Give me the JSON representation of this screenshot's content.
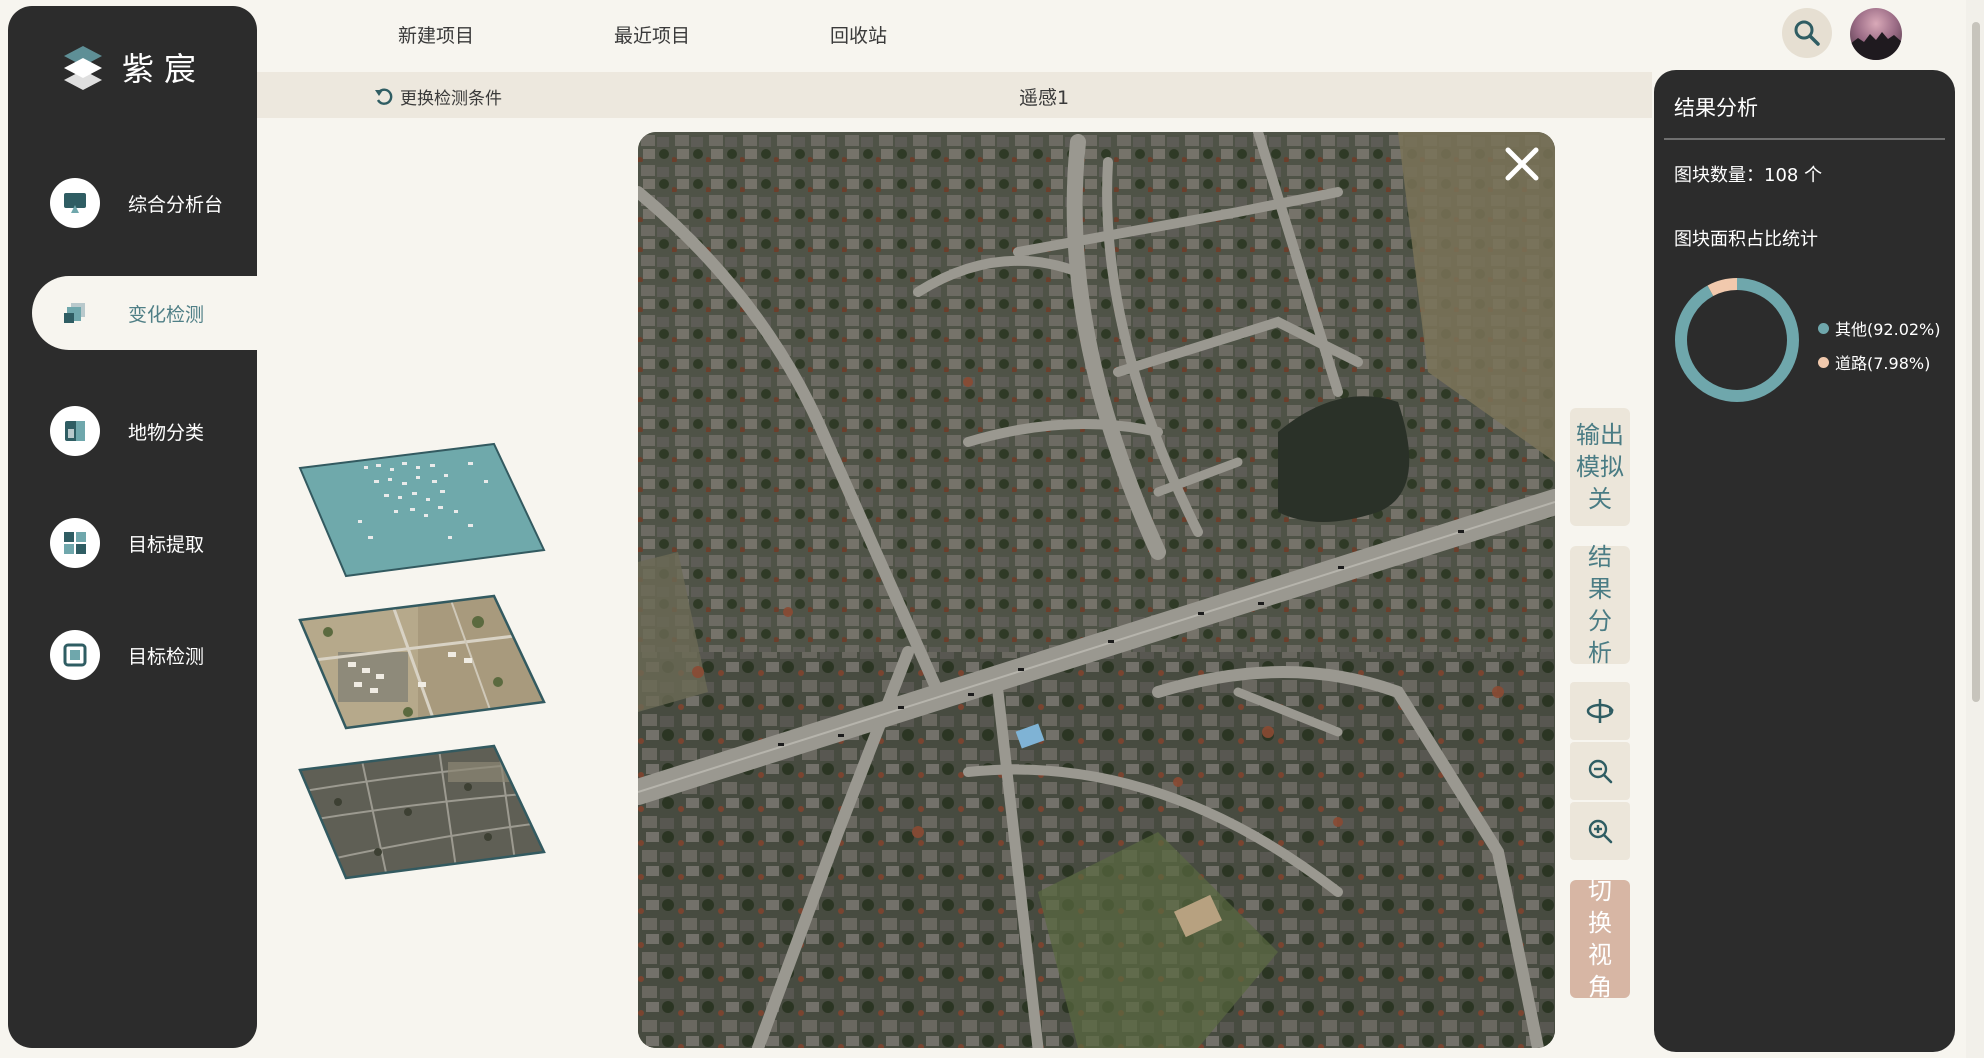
{
  "app": {
    "brand": "紫宸"
  },
  "topnav": {
    "new_project": "新建项目",
    "recent_projects": "最近项目",
    "recycle_bin": "回收站"
  },
  "sidebar": {
    "items": [
      {
        "label": "综合分析台",
        "icon": "monitor-icon"
      },
      {
        "label": "变化检测",
        "icon": "layers-icon",
        "active": true
      },
      {
        "label": "地物分类",
        "icon": "classify-icon"
      },
      {
        "label": "目标提取",
        "icon": "grid-icon"
      },
      {
        "label": "目标检测",
        "icon": "target-icon"
      }
    ]
  },
  "subheader": {
    "reset_label": "更换检测条件",
    "map_title": "遥感1"
  },
  "tools": {
    "output_toggle": "输出模拟关",
    "result_analysis": "结果分析",
    "switch_view": "切换视角"
  },
  "results": {
    "title": "结果分析",
    "count_label": "图块数量：",
    "count_value": "108 个",
    "area_label": "图块面积占比统计",
    "legend": [
      {
        "label": "其他(92.02%)",
        "color": "#6fa7ac",
        "percent": 92.02
      },
      {
        "label": "道路(7.98%)",
        "color": "#f1c9ad",
        "percent": 7.98
      }
    ]
  },
  "colors": {
    "sidebar": "#2c2c2c",
    "accent": "#4f7f86",
    "background": "#f7f5ef",
    "switch": "#d7b6a4"
  }
}
